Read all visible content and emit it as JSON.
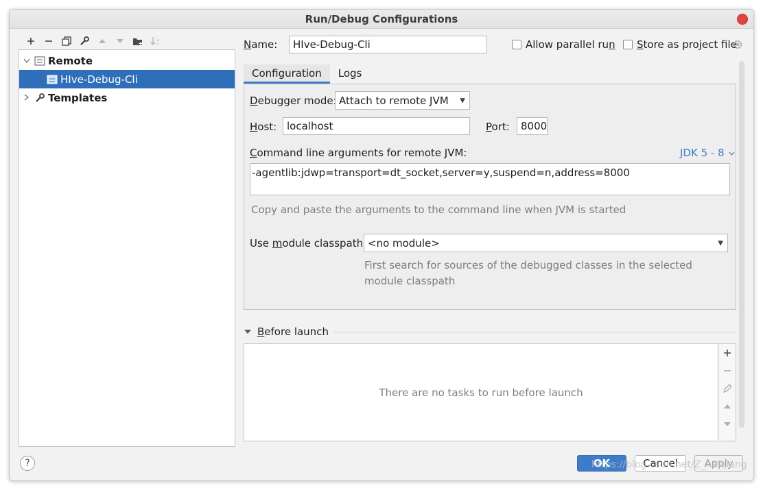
{
  "window": {
    "title": "Run/Debug Configurations"
  },
  "toolbar": {
    "icons": [
      "plus-icon",
      "minus-icon",
      "copy-icon",
      "wrench-icon",
      "arrow-up-icon",
      "arrow-down-icon",
      "new-folder-icon",
      "sort-icon"
    ]
  },
  "tree": {
    "remote": "Remote",
    "config": "HIve-Debug-Cli",
    "templates": "Templates"
  },
  "form": {
    "name_label_prefix": "",
    "name_label_ul": "N",
    "name_label_rest": "ame:",
    "name_value": "HIve-Debug-Cli",
    "allow_parallel": "Allow parallel ru",
    "allow_parallel_ul": "n",
    "store_as_project_ul": "S",
    "store_as_project": "tore as project file"
  },
  "tabs": {
    "configuration": "Configuration",
    "logs": "Logs"
  },
  "config": {
    "debugger_mode_ul": "D",
    "debugger_mode_rest": "ebugger mode:",
    "debugger_mode_value": "Attach to remote JVM",
    "host_ul": "H",
    "host_rest": "ost:",
    "host_value": "localhost",
    "port_ul": "P",
    "port_rest": "ort:",
    "port_value": "8000",
    "cmd_label_ul": "C",
    "cmd_label_rest": "ommand line arguments for remote JVM:",
    "jdk_link": "JDK 5 - 8",
    "cmd_value": "-agentlib:jdwp=transport=dt_socket,server=y,suspend=n,address=8000",
    "cmd_hint": "Copy and paste the arguments to the command line when JVM is started",
    "module_label_a": "Use ",
    "module_label_ul": "m",
    "module_label_b": "odule classpath:",
    "module_value": "<no module>",
    "module_hint_1": "First search for sources of the debugged classes in the selected",
    "module_hint_2": "module classpath"
  },
  "before_launch": {
    "title_ul": "B",
    "title_rest": "efore launch",
    "empty_text": "There are no tasks to run before launch"
  },
  "buttons": {
    "ok": "OK",
    "cancel": "Cancel",
    "apply": "Apply",
    "help": "?"
  },
  "watermark": "https://blog.csdn.net/Z_haiqiang",
  "colors": {
    "accent": "#3d7cc9",
    "selection": "#2f6fba",
    "close": "#e0443e"
  }
}
